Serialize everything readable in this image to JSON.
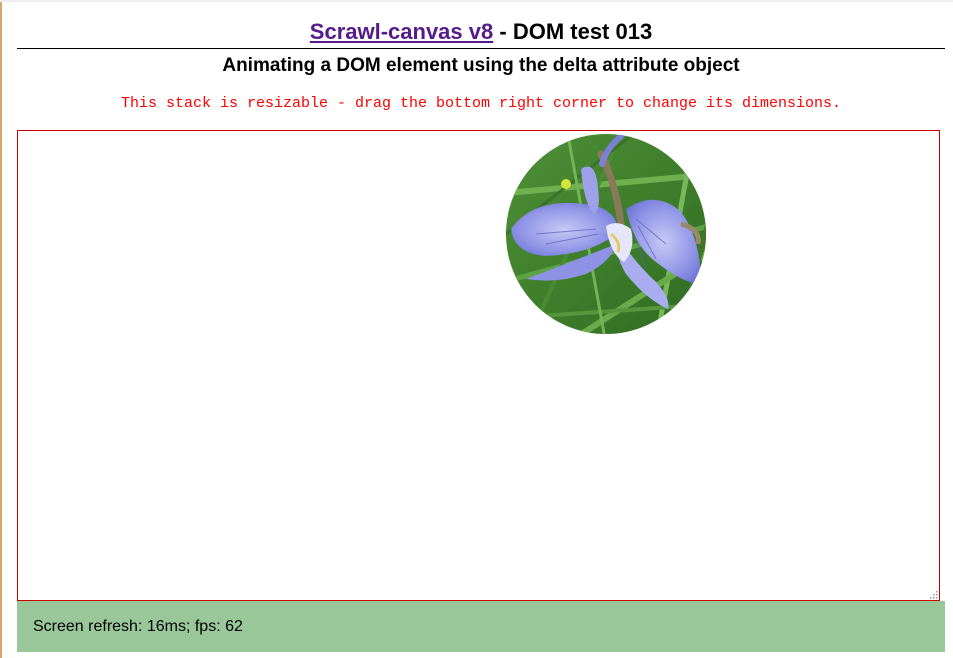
{
  "header": {
    "library_link": "Scrawl-canvas v8",
    "separator": " - ",
    "test_name": "DOM test 013",
    "subtitle": "Animating a DOM element using the delta attribute object"
  },
  "note": "This stack is resizable - drag the bottom right corner to change its dimensions.",
  "stack": {
    "element_icon": "iris-flower-image",
    "grip_icon": "resize-grip-icon"
  },
  "report": {
    "text": "Screen refresh: 16ms; fps: 62"
  },
  "colors": {
    "link": "#551a8b",
    "note": "#ff0000",
    "stack_border": "#cc0000",
    "report_background": "#99c799"
  }
}
